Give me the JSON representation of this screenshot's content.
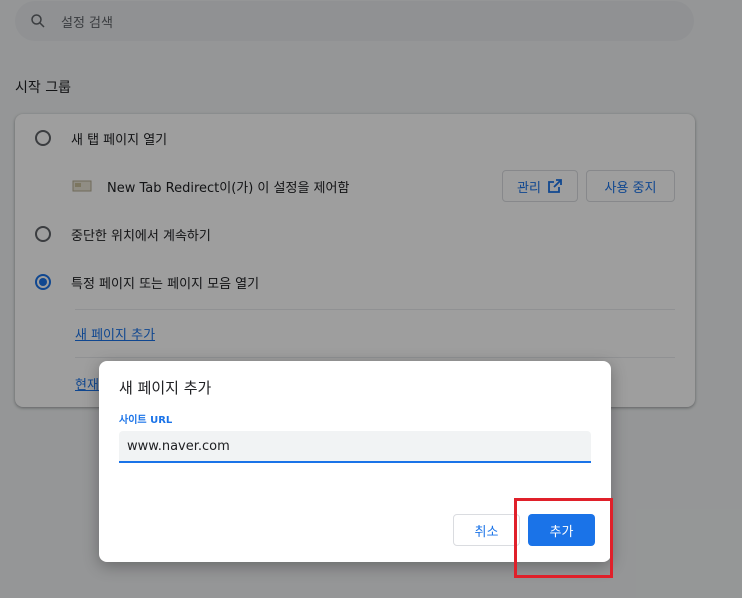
{
  "search": {
    "placeholder": "설정 검색"
  },
  "startup": {
    "title": "시작 그룹",
    "options": [
      {
        "label": "새 탭 페이지 열기",
        "checked": false
      },
      {
        "label": "중단한 위치에서 계속하기",
        "checked": false
      },
      {
        "label": "특정 페이지 또는 페이지 모음 열기",
        "checked": true
      }
    ],
    "extension": {
      "text": "New Tab Redirect이(가) 이 설정을 제어함",
      "manage_label": "관리",
      "disable_label": "사용 중지"
    },
    "add_page_link": "새 페이지 추가",
    "current_pages_link": "현재"
  },
  "dialog": {
    "title": "새 페이지 추가",
    "field_label": "사이트 URL",
    "url_value": "www.naver.com",
    "cancel_label": "취소",
    "add_label": "추가"
  },
  "colors": {
    "accent": "#1a73e8",
    "highlight": "#e0202a"
  }
}
